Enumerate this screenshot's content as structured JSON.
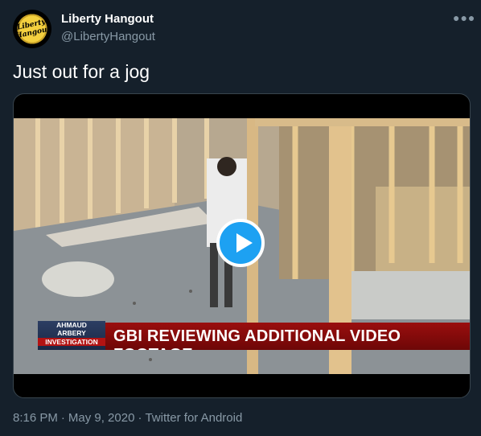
{
  "author": {
    "name": "Liberty Hangout",
    "handle": "@LibertyHangout",
    "avatar_logo_text": "Liberty Hangout"
  },
  "more_menu_icon": "ellipsis-icon",
  "tweet": {
    "text": "Just out for a jog"
  },
  "media": {
    "type": "video",
    "play_icon": "play-icon",
    "chyron_tag_lines": [
      "AHMAUD",
      "ARBERY",
      "INVESTIGATION"
    ],
    "chyron_headline": "GBI REVIEWING ADDITIONAL VIDEO FOOTAGE"
  },
  "meta": {
    "time": "8:16 PM",
    "date": "May 9, 2020",
    "source": "Twitter for Android"
  },
  "colors": {
    "background": "#15202b",
    "secondary_text": "#8899a6",
    "accent": "#1da1f2",
    "chyron_red": "#9a0e0e"
  }
}
